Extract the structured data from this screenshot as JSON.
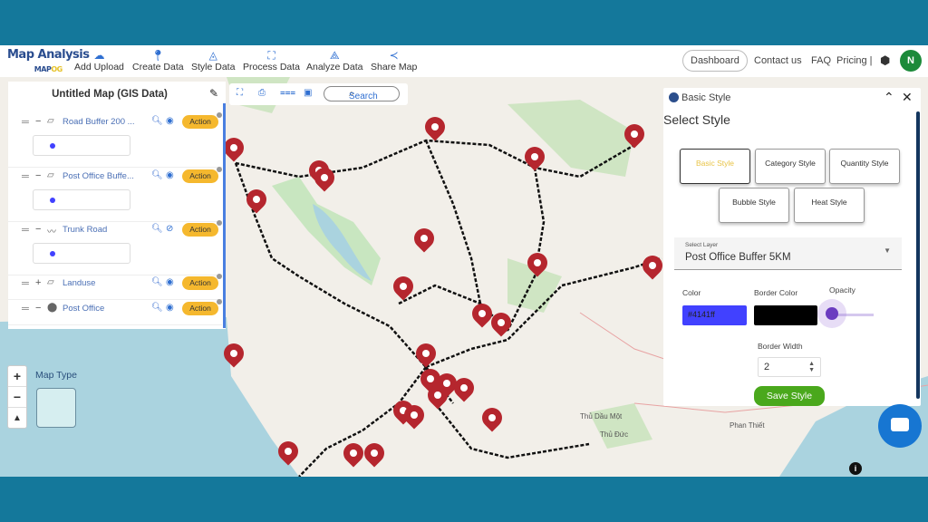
{
  "brand": {
    "title": "Map Analysis",
    "sub_left": "MAP",
    "sub_right": "OG"
  },
  "nav": [
    {
      "label": "Add Upload",
      "icon": "cloud-upload-icon"
    },
    {
      "label": "Create Data",
      "icon": "map-pin-icon"
    },
    {
      "label": "Style Data",
      "icon": "paint-bucket-icon"
    },
    {
      "label": "Process Data",
      "icon": "process-icon"
    },
    {
      "label": "Analyze Data",
      "icon": "analyze-icon"
    },
    {
      "label": "Share Map",
      "icon": "share-icon"
    }
  ],
  "header_right": {
    "dashboard": "Dashboard",
    "contact": "Contact us",
    "faq": "FAQ",
    "pricing": "Pricing |",
    "avatar": "N"
  },
  "layers_panel": {
    "title": "Untitled Map (GIS Data)",
    "layers": [
      {
        "name": "Road Buffer 200 ...",
        "toggle": "−",
        "visible": true,
        "action": "Action",
        "legend_color": "#4141ff"
      },
      {
        "name": "Post Office Buffe...",
        "toggle": "−",
        "visible": true,
        "action": "Action",
        "legend_color": "#4141ff"
      },
      {
        "name": "Trunk Road",
        "toggle": "−",
        "visible": false,
        "action": "Action",
        "legend_color": "#4141ff"
      },
      {
        "name": "Landuse",
        "toggle": "+",
        "visible": true,
        "action": "Action"
      },
      {
        "name": "Post Office",
        "toggle": "−",
        "visible": true,
        "action": "Action"
      }
    ]
  },
  "toolbar": {
    "search_placeholder": "Search"
  },
  "style_panel": {
    "header": "Basic Style",
    "title": "Select Style",
    "styles": [
      "Basic Style",
      "Category Style",
      "Quantity Style",
      "Bubble Style",
      "Heat Style"
    ],
    "active_style": "Basic Style",
    "select_layer_label": "Select Layer",
    "select_layer_value": "Post Office Buffer 5KM",
    "color_label": "Color",
    "color_value": "#4141ff",
    "border_color_label": "Border Color",
    "border_color_value": "#000000",
    "opacity_label": "Opacity",
    "opacity_value": 0,
    "border_width_label": "Border Width",
    "border_width_value": "2",
    "save_label": "Save Style"
  },
  "map": {
    "map_type_label": "Map Type",
    "place_labels": [
      "Thủ Dầu Một",
      "Thủ Đức",
      "Phan Thiết"
    ],
    "marker_color": "#b5262e"
  },
  "colors": {
    "frame": "#14789b",
    "accent": "#2f6fd1",
    "action": "#f5b82e",
    "save": "#4aa81c"
  }
}
